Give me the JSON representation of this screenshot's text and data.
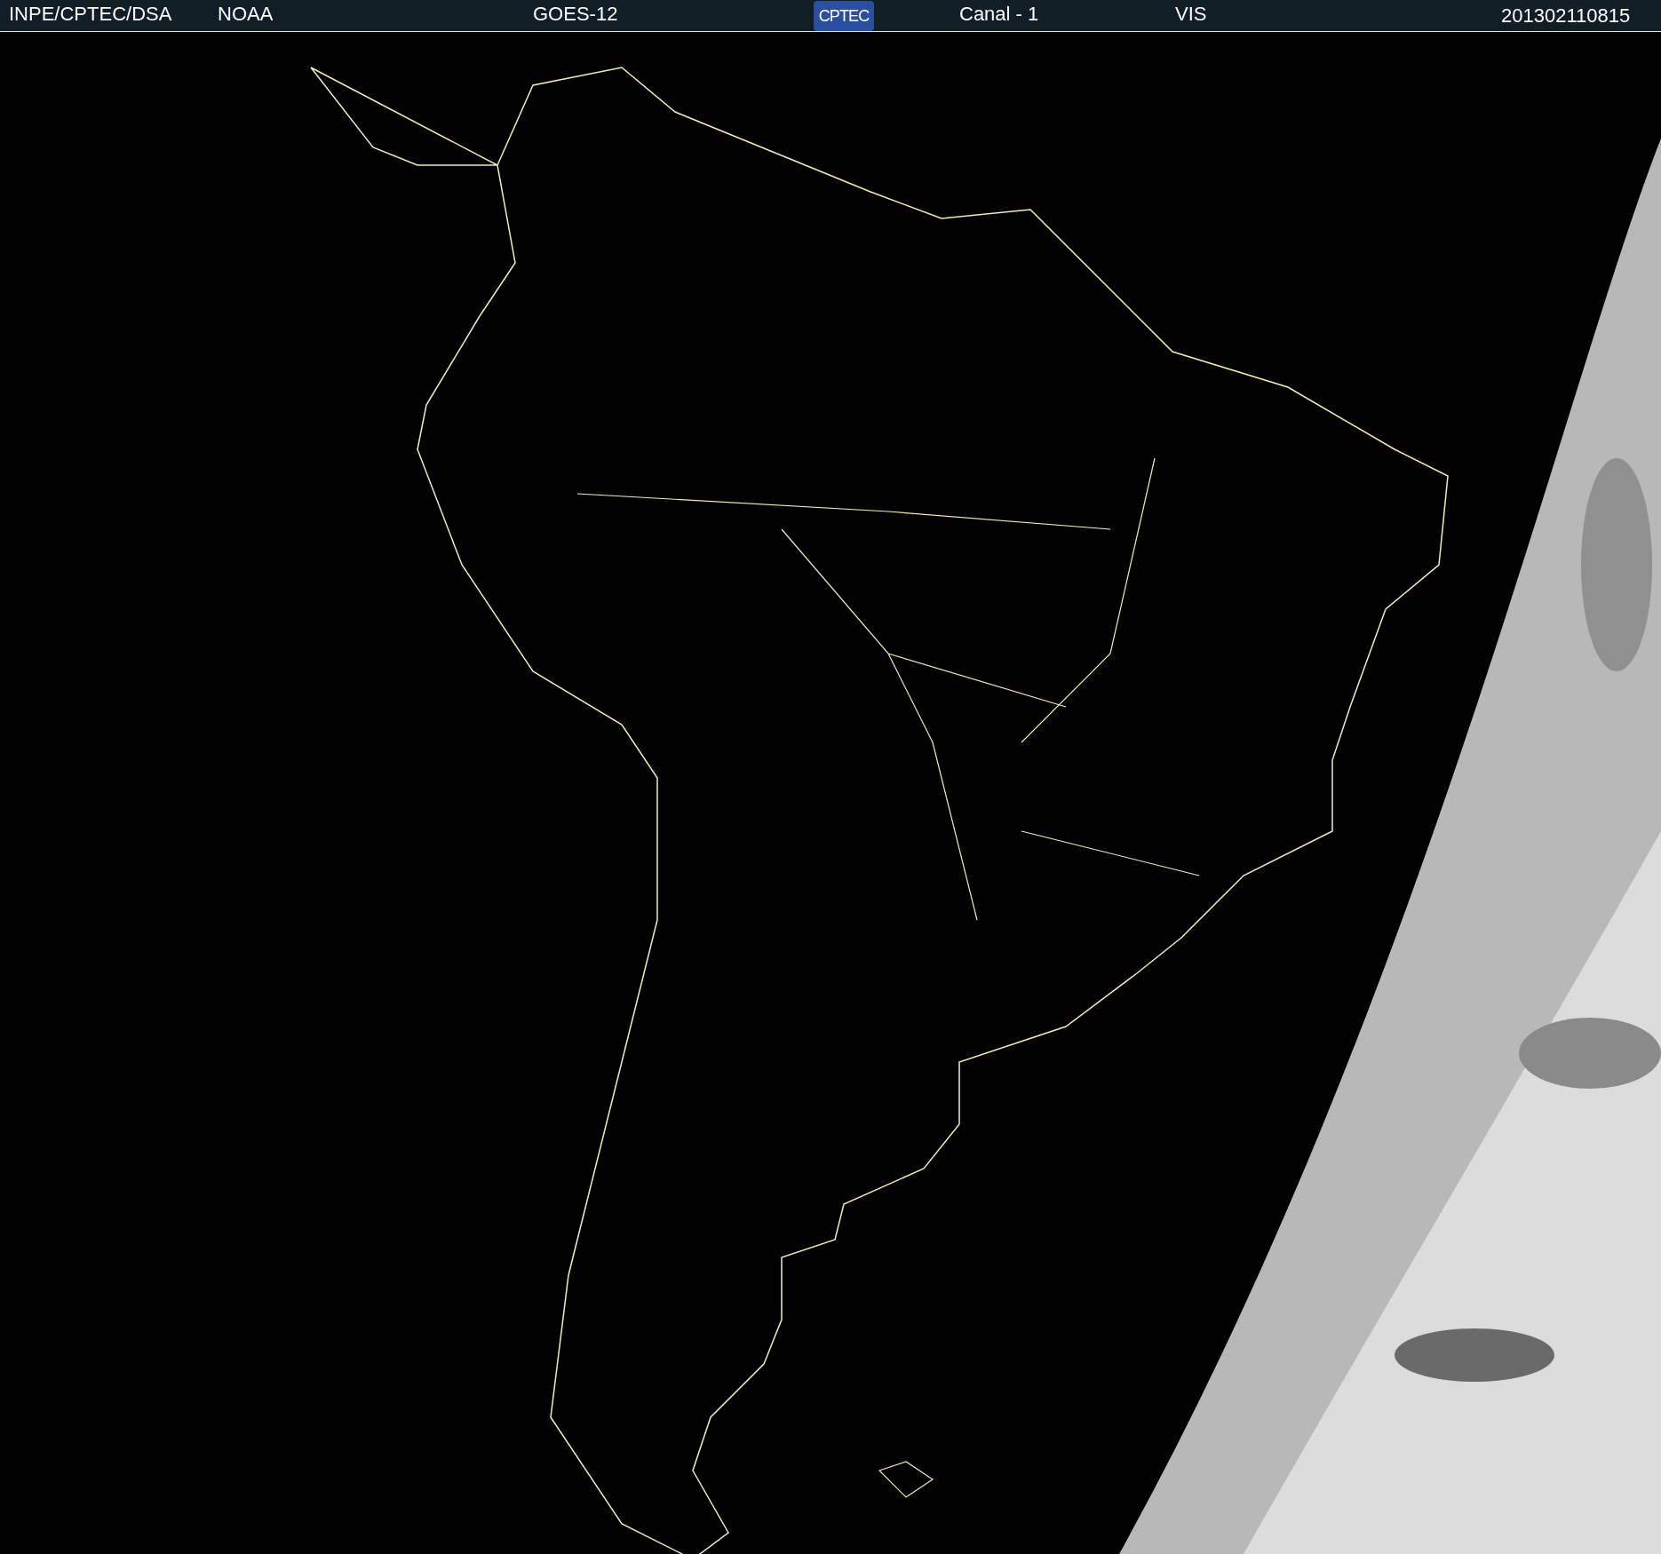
{
  "header": {
    "source": "INPE/CPTEC/DSA",
    "agency": "NOAA",
    "satellite": "GOES-12",
    "logo": "CPTEC",
    "channel": "Canal - 1",
    "band": "VIS",
    "timestamp": "201302110815"
  }
}
